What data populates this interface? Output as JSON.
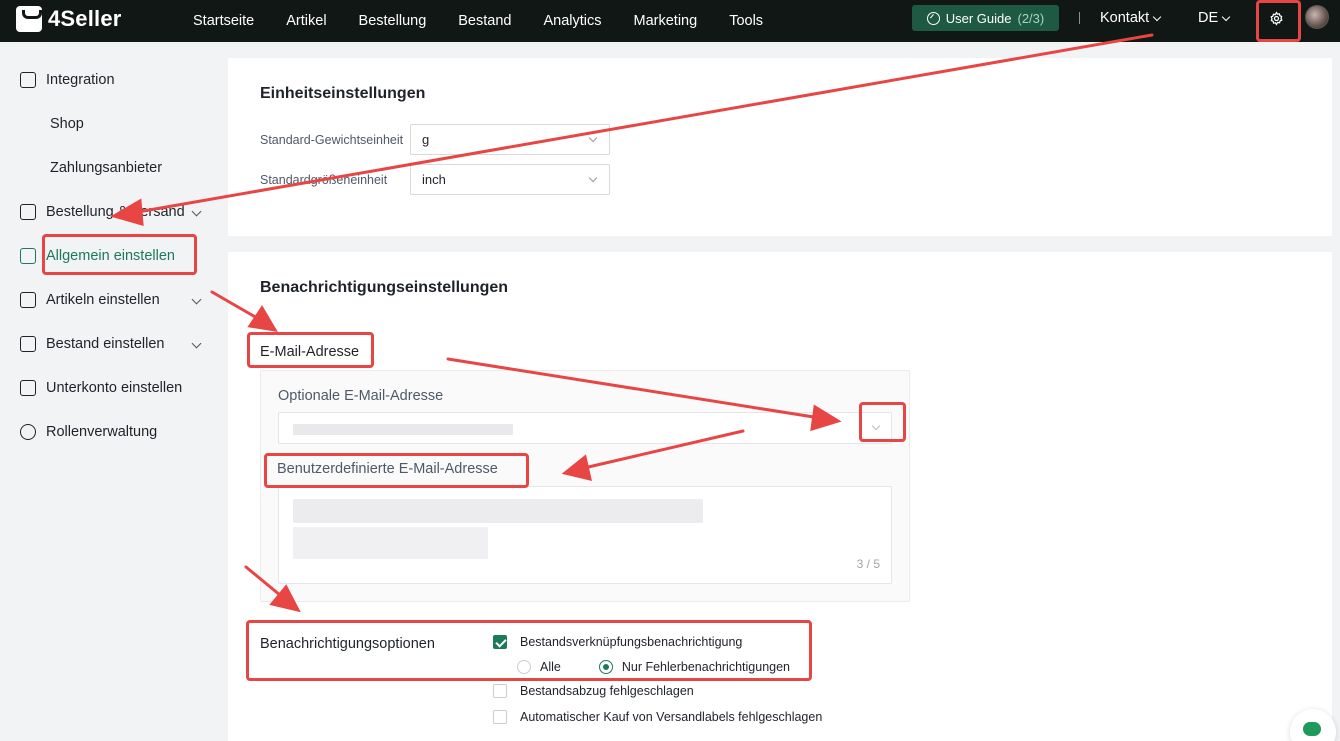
{
  "app": {
    "brand": "4Seller"
  },
  "nav": {
    "items": [
      "Startseite",
      "Artikel",
      "Bestellung",
      "Bestand",
      "Analytics",
      "Marketing",
      "Tools"
    ],
    "user_guide_label": "User Guide",
    "user_guide_progress": "(2/3)",
    "contact": "Kontakt",
    "language": "DE"
  },
  "sidebar": {
    "items": [
      {
        "label": "Integration",
        "icon": "store-icon"
      },
      {
        "label": "Shop"
      },
      {
        "label": "Zahlungsanbieter"
      },
      {
        "label": "Bestellung & Versand",
        "icon": "order-icon"
      },
      {
        "label": "Allgemein einstellen",
        "icon": "settings-doc-icon"
      },
      {
        "label": "Artikeln einstellen",
        "icon": "upload-icon"
      },
      {
        "label": "Bestand einstellen",
        "icon": "warehouse-icon"
      },
      {
        "label": "Unterkonto einstellen",
        "icon": "subaccount-icon"
      },
      {
        "label": "Rollenverwaltung",
        "icon": "user-icon"
      }
    ]
  },
  "units": {
    "title": "Einheitseinstellungen",
    "weight_label": "Standard-Gewichtseinheit",
    "weight_value": "g",
    "size_label": "Standardgrößeneinheit",
    "size_value": "inch"
  },
  "notifications": {
    "title": "Benachrichtigungseinstellungen",
    "email_label": "E-Mail-Adresse",
    "optional_label": "Optionale E-Mail-Adresse",
    "custom_label": "Benutzerdefinierte E-Mail-Adresse",
    "counter": "3 / 5",
    "options_label": "Benachrichtigungsoptionen",
    "opt1": "Bestandsverknüpfungsbenachrichtigung",
    "radio_all": "Alle",
    "radio_errors": "Nur Fehlerbenachrichtigungen",
    "opt2": "Bestandsabzug fehlgeschlagen",
    "opt3": "Automatischer Kauf von Versandlabels fehlgeschlagen"
  },
  "colors": {
    "accent": "#1d7a56",
    "topbar": "#111714",
    "annotation": "#e84545"
  }
}
